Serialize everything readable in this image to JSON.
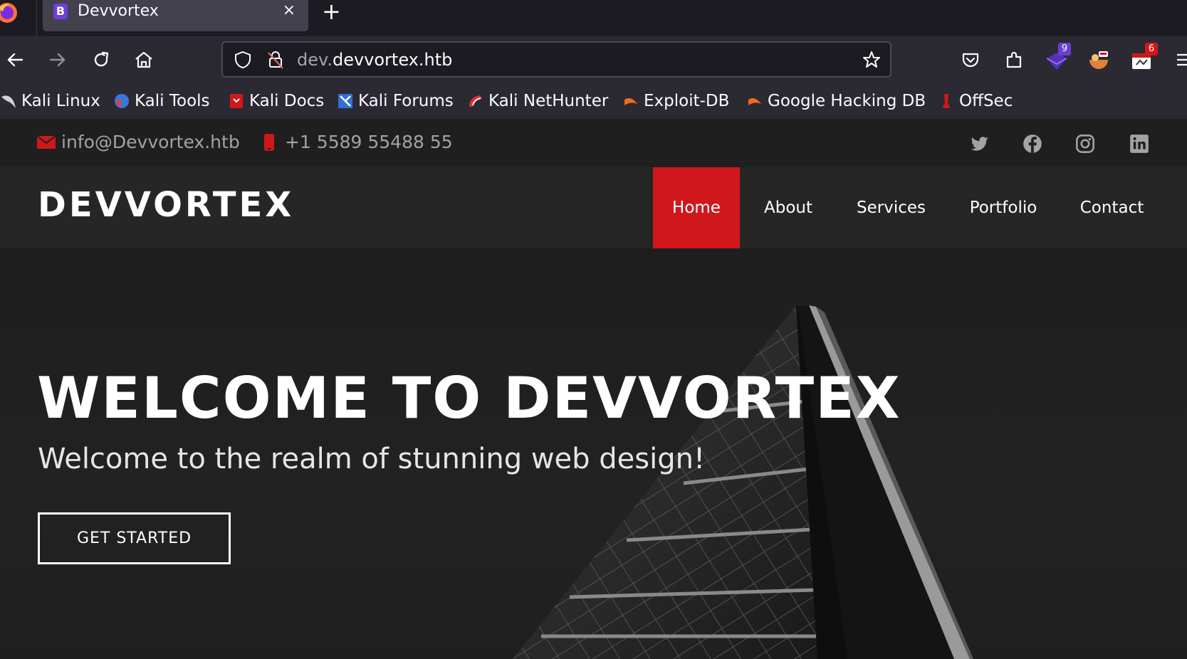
{
  "browser": {
    "tab": {
      "favicon_letter": "B",
      "title": "Devvortex",
      "close": "×"
    },
    "new_tab": "+",
    "url": {
      "prefix": "dev.",
      "domain": "devvortex.htb"
    },
    "extensions": {
      "badge1": "9",
      "badge2": "6"
    },
    "bookmarks": [
      {
        "label": "Kali Linux"
      },
      {
        "label": "Kali Tools"
      },
      {
        "label": "Kali Docs"
      },
      {
        "label": "Kali Forums"
      },
      {
        "label": "Kali NetHunter"
      },
      {
        "label": "Exploit-DB"
      },
      {
        "label": "Google Hacking DB"
      },
      {
        "label": "OffSec"
      }
    ]
  },
  "site": {
    "topbar": {
      "email": "info@Devvortex.htb",
      "phone": "+1 5589 55488 55"
    },
    "logo": "DEVVORTEX",
    "nav": [
      {
        "label": "Home"
      },
      {
        "label": "About"
      },
      {
        "label": "Services"
      },
      {
        "label": "Portfolio"
      },
      {
        "label": "Contact"
      }
    ],
    "hero": {
      "title": "WELCOME TO DEVVORTEX",
      "subtitle": "Welcome to the realm of stunning web design!",
      "cta": "GET STARTED"
    }
  },
  "colors": {
    "accent": "#d0171c",
    "chrome_dark": "#1c1b22",
    "chrome": "#2b2a33",
    "site_topbar": "#1f1f1f",
    "site_header": "#262626"
  }
}
